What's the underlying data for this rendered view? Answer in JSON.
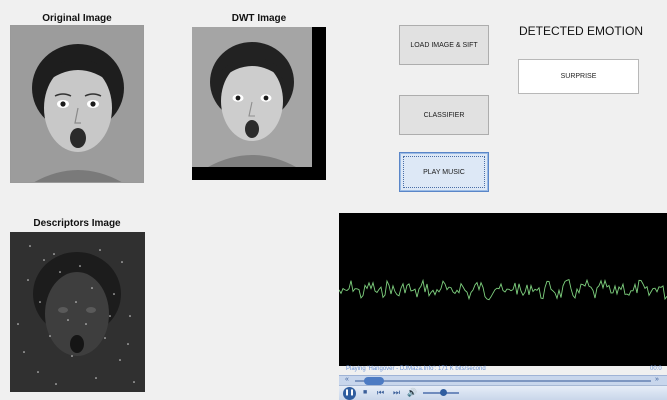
{
  "labels": {
    "original": "Original Image",
    "dwt": "DWT Image",
    "descriptors": "Descriptors Image",
    "detected_emotion": "DETECTED EMOTION"
  },
  "buttons": {
    "load": "LOAD IMAGE & SIFT",
    "classifier": "CLASSIFIER",
    "play": "PLAY MUSIC"
  },
  "result": {
    "emotion": "SURPRISE"
  },
  "player": {
    "status": "Playing 'Hangover - DJMaza.Info': 171 K bits/second",
    "time": "00:0",
    "seek_position": 0.03,
    "volume_level": 0.55
  },
  "icons": {
    "seek_left": "«",
    "seek_right": "»",
    "pause": "❚❚",
    "stop": "■",
    "prev": "⏮",
    "next": "⏭",
    "volume": "🔊"
  }
}
